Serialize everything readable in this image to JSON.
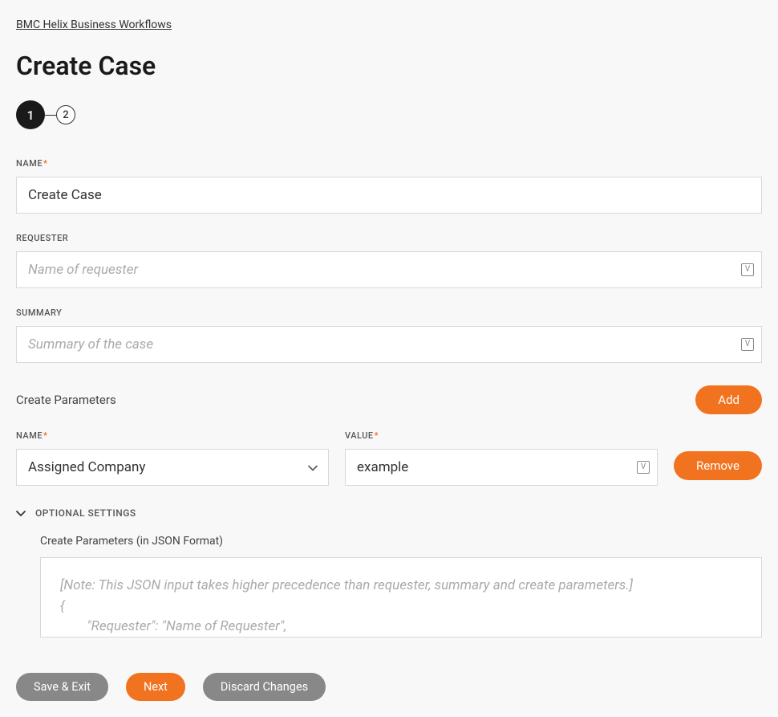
{
  "breadcrumb": "BMC Helix Business Workflows",
  "page_title": "Create Case",
  "stepper": {
    "step1": "1",
    "step2": "2"
  },
  "fields": {
    "name": {
      "label": "NAME",
      "value": "Create Case"
    },
    "requester": {
      "label": "REQUESTER",
      "placeholder": "Name of requester",
      "value": ""
    },
    "summary": {
      "label": "SUMMARY",
      "placeholder": "Summary of the case",
      "value": ""
    }
  },
  "params": {
    "heading": "Create Parameters",
    "add_label": "Add",
    "name_label": "NAME",
    "value_label": "VALUE",
    "remove_label": "Remove",
    "rows": [
      {
        "name": "Assigned Company",
        "value": "example"
      }
    ]
  },
  "optional": {
    "toggle_label": "OPTIONAL SETTINGS",
    "json_label": "Create Parameters (in JSON Format)",
    "json_placeholder": "[Note: This JSON input takes higher precedence than requester, summary and create parameters.]\n{\n        \"Requester\": \"Name of Requester\","
  },
  "footer": {
    "save_exit": "Save & Exit",
    "next": "Next",
    "discard": "Discard Changes"
  },
  "variable_glyph": "V"
}
